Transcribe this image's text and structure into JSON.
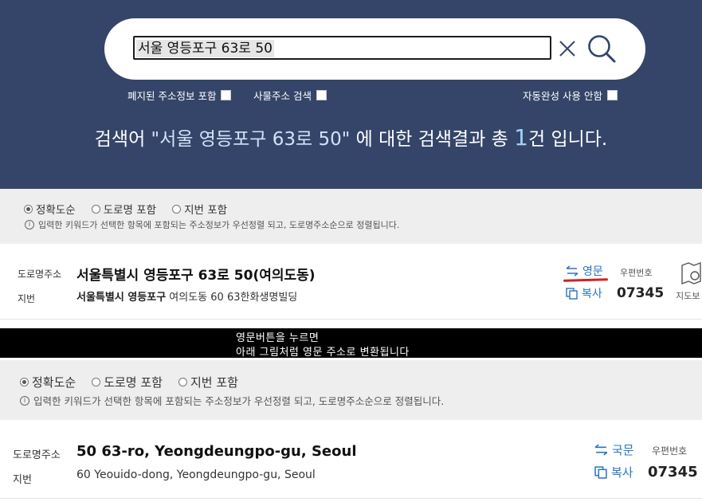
{
  "search": {
    "query": "서울 영등포구 63로 50",
    "opt_closed": "폐지된 주소정보 포함",
    "opt_thing": "사물주소 검색",
    "opt_autocomplete": "자동완성 사용 안함"
  },
  "result_summary": {
    "prefix": "검색어 ",
    "query_quoted": "\"서울 영등포구 63로 50\"",
    "middle": " 에 대한 검색결과 총 ",
    "count": "1",
    "suffix": "건 입니다."
  },
  "filters_top": {
    "options": [
      "정확도순",
      "도로명 포함",
      "지번 포함"
    ],
    "info": "입력한 키워드가 선택한 항목에 포함되는 주소정보가 우선정렬 되고, 도로명주소순으로 정렬됩니다."
  },
  "result_ko": {
    "road_label": "도로명주소",
    "road_address": "서울특별시 영등포구 63로 50(여의도동)",
    "jibun_label": "지번",
    "jibun_bold": "서울특별시 영등포구",
    "jibun_rest": " 여의도동 60 63한화생명빌딩",
    "lang_button": "영문",
    "copy_button": "복사",
    "postal_label": "우편번호",
    "postal_code": "07345",
    "map_label": "지도보"
  },
  "notice": {
    "line1": "영문버튼을 누르면",
    "line2": "아래 그림처럼 영문 주소로 변환됩니다"
  },
  "filters_bottom": {
    "options": [
      "정확도순",
      "도로명 포함",
      "지번 포함"
    ],
    "info": "입력한 키워드가 선택한 항목에 포함되는 주소정보가 우선정렬 되고, 도로명주소순으로 정렬됩니다."
  },
  "result_en": {
    "road_label": "도로명주소",
    "road_address": "50 63-ro, Yeongdeungpo-gu, Seoul",
    "jibun_label": "지번",
    "jibun_address": "60 Yeouido-dong, Yeongdeungpo-gu, Seoul",
    "lang_button": "국문",
    "copy_button": "복사",
    "postal_label": "우편번호",
    "postal_code": "07345"
  },
  "colors": {
    "hero_bg": "#354569",
    "link_blue": "#2a75c0",
    "highlight_red": "#d42020",
    "panel_grey": "#eeeeee"
  }
}
